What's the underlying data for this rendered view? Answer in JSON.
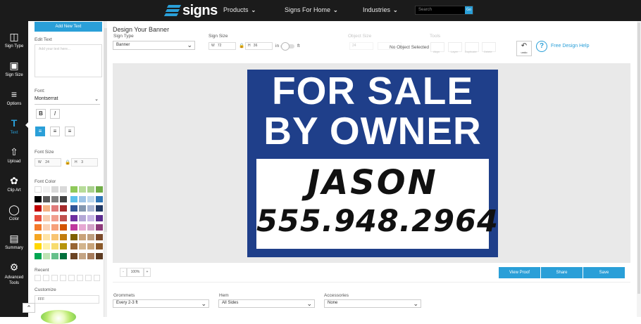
{
  "header": {
    "logo_text": "signs",
    "nav": [
      {
        "label": "Products"
      },
      {
        "label": "Signs For Home"
      },
      {
        "label": "Industries"
      }
    ],
    "search_placeholder": "Search",
    "go_label": "Go"
  },
  "sidebar": {
    "items": [
      {
        "label": "Sign Type",
        "icon": "sign-type-icon"
      },
      {
        "label": "Sign Size",
        "icon": "sign-size-icon"
      },
      {
        "label": "Options",
        "icon": "options-icon"
      },
      {
        "label": "Text",
        "icon": "text-icon"
      },
      {
        "label": "Upload",
        "icon": "upload-icon"
      },
      {
        "label": "Clip Art",
        "icon": "clipart-icon"
      },
      {
        "label": "Color",
        "icon": "color-icon"
      },
      {
        "label": "Summary",
        "icon": "summary-icon"
      },
      {
        "label": "Advanced Tools",
        "icon": "gear-icon"
      }
    ],
    "active": "Text"
  },
  "text_panel": {
    "add_button": "Add New Text",
    "edit_label": "Edit Text",
    "textarea_placeholder": "Add your text here...",
    "font_label": "Font:",
    "font_value": "Montserrat",
    "bold": "B",
    "italic": "I",
    "size_label": "Font Size",
    "width_label": "W",
    "width_value": "24",
    "height_label": "H",
    "height_value": "3",
    "color_label": "Font Color",
    "recent_label": "Recent",
    "customize_label": "Customize",
    "custom_value": "FFF",
    "colors": [
      [
        "#ffffff",
        "#f2f2f2",
        "#d9d9d9",
        "#d9d9d9",
        "#8fc95a",
        "#b7dc9a",
        "#a9d18e",
        "#70ad47"
      ],
      [
        "#000000",
        "#595959",
        "#7f7f7f",
        "#404040",
        "#5bc0eb",
        "#9dc3e6",
        "#bdd7ee",
        "#2e75b6"
      ],
      [
        "#c00000",
        "#f4b183",
        "#e07b7b",
        "#a52a2a",
        "#2f5597",
        "#8497b0",
        "#a9b6d4",
        "#203864"
      ],
      [
        "#e74c3c",
        "#f8cbad",
        "#f19e8f",
        "#c0504d",
        "#7030a0",
        "#b4a7d6",
        "#c9b8e6",
        "#5b2c8f"
      ],
      [
        "#f4792a",
        "#fbd1b5",
        "#f6a07a",
        "#d35400",
        "#c0399e",
        "#e6a7d2",
        "#d4a3c9",
        "#8e3a7a"
      ],
      [
        "#f5a623",
        "#ffe4a8",
        "#f8c471",
        "#c27c0e",
        "#7f6000",
        "#c9a37a",
        "#bf9f7f",
        "#7b4a2a"
      ],
      [
        "#ffd700",
        "#fff2a8",
        "#f7dc6f",
        "#b7950b",
        "#996633",
        "#d2b48c",
        "#c8a47a",
        "#8b5a2b"
      ],
      [
        "#00a651",
        "#bfe3b4",
        "#66c08b",
        "#00703c",
        "#6b4423",
        "#c4a484",
        "#a67b5b",
        "#5c3a21"
      ]
    ]
  },
  "design": {
    "title": "Design Your Banner",
    "sign_type_label": "Sign Type",
    "sign_type_value": "Banner",
    "sign_size_label": "Sign Size",
    "width_label": "W",
    "width_value": "72",
    "height_label": "H",
    "height_value": "36",
    "unit_in": "in",
    "unit_ft": "ft",
    "object_size_label": "Object Size",
    "object_w": "24",
    "no_object": "No Object Selected",
    "tools_label": "Tools",
    "tool_labels": [
      "Align",
      "Layer",
      "Duplicate",
      "Delete"
    ],
    "undo_label": "undo",
    "help_label": "Free Design Help"
  },
  "sign": {
    "line1": "FOR SALE",
    "line2": "BY OWNER",
    "name": "JASON",
    "phone": "555.948.2964",
    "bg_color": "#1f3f8a"
  },
  "canvas_bar": {
    "zoom_minus": "-",
    "zoom_plus": "+",
    "zoom_value": "100%",
    "view_proof": "View Proof",
    "share": "Share",
    "save": "Save"
  },
  "options": {
    "grommets_label": "Grommets",
    "grommets_value": "Every 2-3 ft",
    "hem_label": "Hem",
    "hem_value": "All Sides",
    "accessories_label": "Accessories",
    "accessories_value": "None"
  }
}
